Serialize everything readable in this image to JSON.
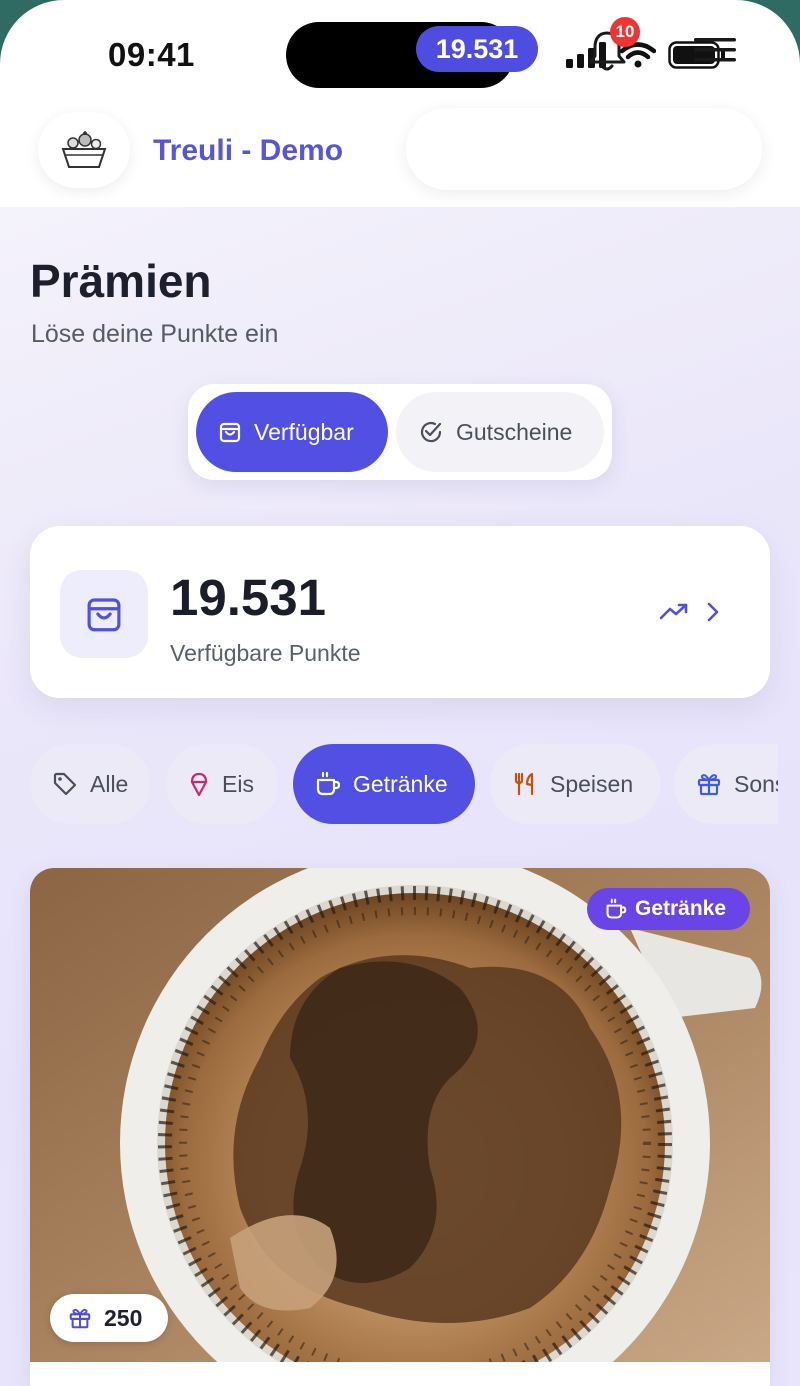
{
  "status_bar": {
    "time": "09:41"
  },
  "header": {
    "brand": "Treuli - Demo",
    "points": "19.531",
    "notification_count": "10"
  },
  "page": {
    "title": "Prämien",
    "subtitle": "Löse deine Punkte ein"
  },
  "tabs": [
    {
      "label": "Verfügbar",
      "icon": "shopping-bag-icon",
      "active": true
    },
    {
      "label": "Gutscheine",
      "icon": "check-circle-icon",
      "active": false
    }
  ],
  "points_card": {
    "value": "19.531",
    "label": "Verfügbare Punkte"
  },
  "categories": [
    {
      "label": "Alle",
      "icon": "tag-icon",
      "active": false
    },
    {
      "label": "Eis",
      "icon": "ice-cream-icon",
      "active": false
    },
    {
      "label": "Getränke",
      "icon": "coffee-cup-icon",
      "active": true
    },
    {
      "label": "Speisen",
      "icon": "fork-knife-icon",
      "active": false
    },
    {
      "label": "Sons",
      "icon": "gift-icon",
      "active": false
    }
  ],
  "reward": {
    "category": "Getränke",
    "cost": "250"
  },
  "colors": {
    "accent": "#5150e2",
    "brand_text": "#5755d9",
    "badge_purple": "#6a44e6",
    "notification_red": "#ef3434"
  }
}
